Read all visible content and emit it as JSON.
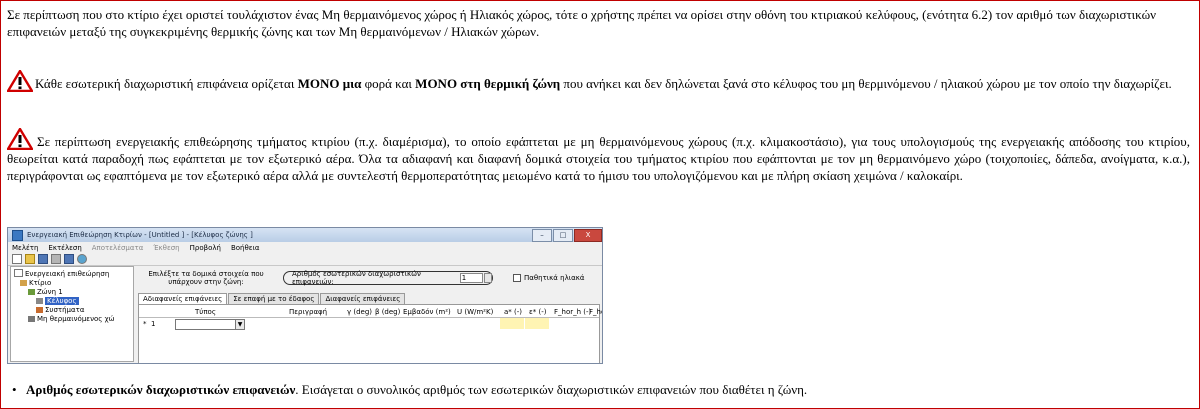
{
  "paragraph1": "Σε περίπτωση που στο κτίριο έχει οριστεί τουλάχιστον ένας Μη θερμαινόμενος χώρος ή Ηλιακός χώρος, τότε ο χρήστης πρέπει να ορίσει στην οθόνη του κτιριακού κελύφους, (ενότητα 6.2) τον αριθμό των διαχωριστικών επιφανειών μεταξύ της συγκεκριμένης θερμικής ζώνης και των Μη θερμαινόμενων / Ηλιακών χώρων.",
  "warning1": {
    "part1": "Κάθε εσωτερική διαχωριστική επιφάνεια ορίζεται ",
    "bold1": "ΜΟΝΟ μια",
    "part2": " φορά και ",
    "bold2": "ΜΟΝΟ στη θερμική ζώνη",
    "part3": " που ανήκει και δεν δηλώνεται ξανά στο κέλυφος του μη θερμινόμενου / ηλιακού χώρου με τον οποίο την διαχωρίζει."
  },
  "warning2": "Σε περίπτωση ενεργειακής επιθεώρησης τμήματος κτιρίου (π.χ. διαμέρισμα), το οποίο εφάπτεται με μη θερμαινόμενους χώρους (π.χ. κλιμακοστάσιο), για τους υπολογισμούς της ενεργειακής απόδοσης του κτιρίου, θεωρείται κατά παραδοχή πως εφάπτεται με τον εξωτερικό αέρα. Όλα τα αδιαφανή και διαφανή δομικά στοιχεία του τμήματος κτιρίου που εφάπτονται με τον μη θερμαινόμενο χώρο (τοιχοποιίες, δάπεδα, ανοίγματα, κ.α.), περιγράφονται ως εφαπτόμενα με τον εξωτερικό αέρα αλλά με συντελεστή θερμοπερατότητας μειωμένο κατά το ήμισυ του υπολογιζόμενου και με πλήρη σκίαση χειμώνα / καλοκαίρι.",
  "app": {
    "title": "Ενεργειακή Επιθεώρηση Κτιρίων - [Untitled ] - [Κέλυφος ζώνης ]",
    "window_buttons": [
      "–",
      "□",
      "X"
    ],
    "menu": [
      "Μελέτη",
      "Εκτέλεση",
      "Αποτελέσματα",
      "Έκθεση",
      "Προβολή",
      "Βοήθεια"
    ],
    "tree": {
      "root": "Ενεργειακή επιθεώρηση",
      "building": "Κτίριο",
      "zone": "Ζώνη 1",
      "envelope": "Κέλυφος",
      "systems": "Συστήματα",
      "unheated": "Μη θερμαινόμενος χώ"
    },
    "select_hint": "Επιλέξτε τα δομικά στοιχεία που υπάρχουν στην ζώνη:",
    "num_label": "Αριθμός εσωτερικών διαχωριστικών επιφανειών:",
    "num_value": "1",
    "passive_label": "Παθητικά ηλιακά",
    "tabs": [
      "Αδιαφανείς επιφάνειες",
      "Σε επαφή με το έδαφος",
      "Διαφανείς επιφάνειες"
    ],
    "columns": [
      "Τύπος",
      "Περιγραφή",
      "γ (deg)",
      "β (deg)",
      "Εμβαδόν (m²)",
      "U (W/m²K)",
      "a* (-)",
      "ε* (-)",
      "F_hor_h (-)",
      "F_ho"
    ],
    "row_marker": "*",
    "row_number": "1"
  },
  "bullet": {
    "bold": "Αριθμός εσωτερικών διαχωριστικών επιφανειών",
    "text": ". Εισάγεται ο συνολικός αριθμός των εσωτερικών διαχωριστικών επιφανειών που διαθέτει η ζώνη."
  }
}
